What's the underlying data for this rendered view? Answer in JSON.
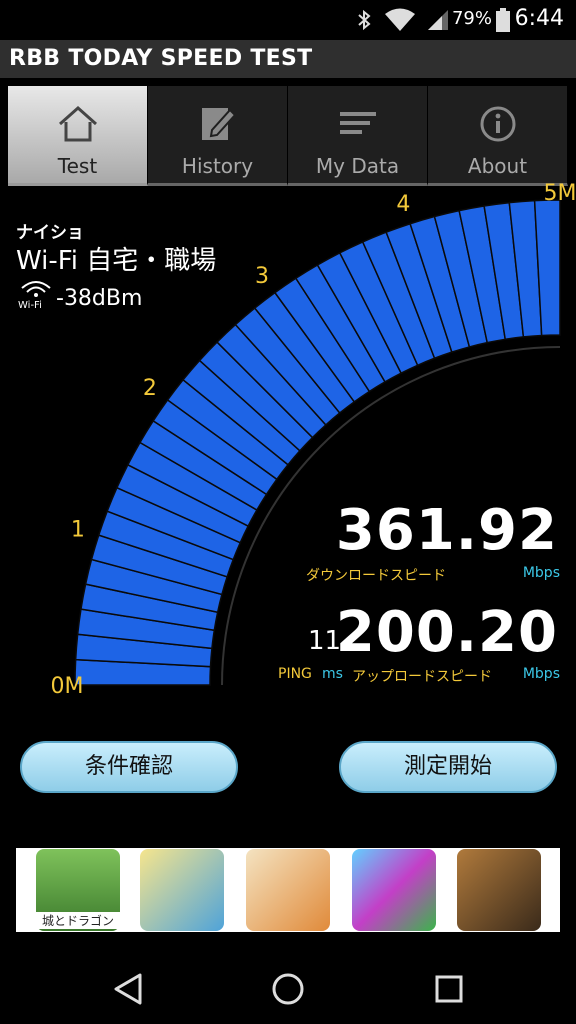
{
  "status_bar": {
    "battery_percent": "79%",
    "time": "6:44"
  },
  "app": {
    "title": "RBB TODAY SPEED TEST"
  },
  "tabs": [
    {
      "label": "Test",
      "icon": "home-icon",
      "active": true
    },
    {
      "label": "History",
      "icon": "edit-icon",
      "active": false
    },
    {
      "label": "My Data",
      "icon": "list-icon",
      "active": false
    },
    {
      "label": "About",
      "icon": "info-icon",
      "active": false
    }
  ],
  "network": {
    "name": "ナイショ",
    "type": "Wi-Fi 自宅・職場",
    "wifi_label": "Wi-Fi",
    "signal": "-38dBm"
  },
  "gauge": {
    "labels": [
      "0M",
      "1",
      "2",
      "3",
      "4",
      "5M"
    ],
    "level": 1.0,
    "fill_color": "#1e64e6"
  },
  "results": {
    "download_speed": "361.92",
    "download_label": "ダウンロードスピード",
    "download_unit": "Mbps",
    "upload_speed": "200.20",
    "upload_label": "アップロードスピード",
    "upload_unit": "Mbps",
    "ping_value": "11",
    "ping_label": "PING",
    "ping_unit": "ms"
  },
  "buttons": {
    "conditions": "条件確認",
    "start": "測定開始"
  },
  "ad": {
    "first_icon_caption": "城とドラゴン",
    "icons": [
      "castle-dragon-game-icon",
      "anime-character-icon",
      "cartoon-man-icon",
      "puzzle-quest-icon",
      "soldier-game-icon"
    ]
  },
  "colors": {
    "accent_yellow": "#f3c93a",
    "accent_cyan": "#3cc8e8",
    "button_blue": "#a9ddf2"
  }
}
